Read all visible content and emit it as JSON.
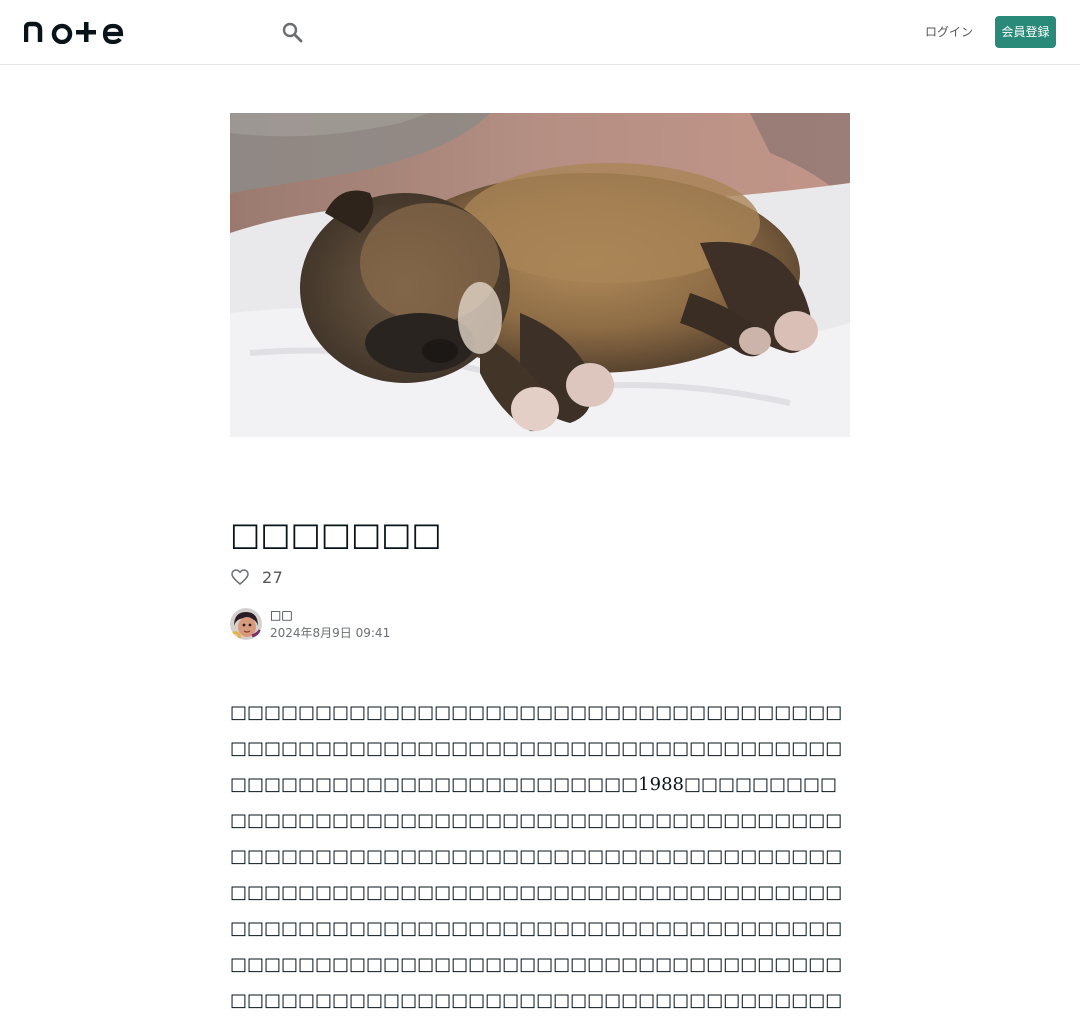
{
  "header": {
    "logo_text": "note",
    "login_label": "ログイン",
    "signup_label": "会員登録",
    "brand_color": "#2a8a79"
  },
  "article": {
    "title": "□□□□□□□",
    "likes": "27",
    "author_name": "□□",
    "date": "2024年8月9日 09:41",
    "body": "□□□□□□□□□□□□□□□□□□□□□□□□□□□□□□□□□□□□□□□□□□□□□□□□□□□□□□□□□□□□□□□□□□□□□□□□□□□□□□□□□□□□□□□□□□□□□□□□1988□□□□□□□□□□□□□□□□□□□□□□□□□□□□□□□□□□□□□□□□□□□□□□□□□□□□□□□□□□□□□□□□□□□□□□□□□□□□□□□□□□□□□□□□□□□□□□□□□□□□□□□□□□□□□□□□□□□□□□□□□□□□□□□□□□□□□□□□□□□□□□□□□□□□□□□□□□□□□□□□□□□□□□□□□□□□□□□□□□□□□□□□□□□□□□□□□□□□□□□□□□□□□□□□□□□□□□□□□□□□□□□□□□□□□□□□□□□□□□□□□□□□□□□□□□□□□□□□□□□□□□□□□□□□□□□□□□□□□□□□□□□□□□□□□□□□□□□□□□□□□□□□□□□□□□"
  },
  "icons": {
    "search": "search-icon",
    "like": "heart-icon"
  }
}
